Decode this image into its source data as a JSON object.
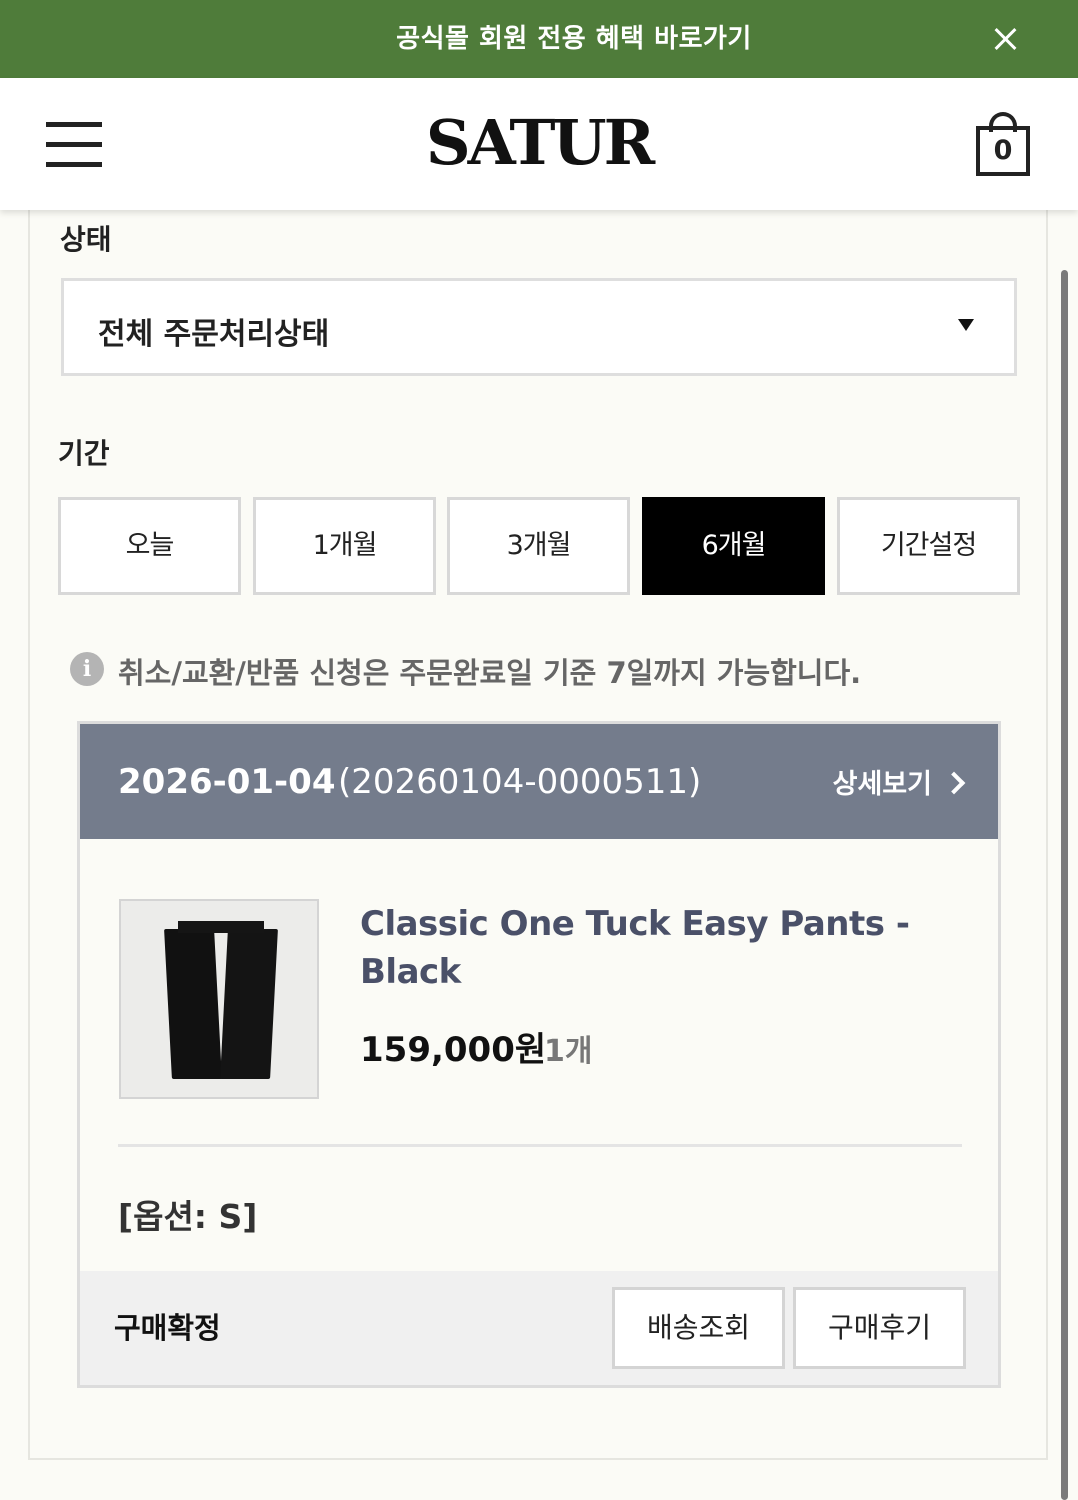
{
  "promo": {
    "text": "공식몰 회원 전용 혜택 바로가기",
    "close_icon": "close-icon"
  },
  "header": {
    "logo": "SATUR",
    "cart_count": "0",
    "menu_icon": "hamburger-icon",
    "cart_icon": "shopping-bag-icon"
  },
  "filter": {
    "status_label": "상태",
    "status_selected": "전체 주문처리상태",
    "period_label": "기간",
    "periods": [
      "오늘",
      "1개월",
      "3개월",
      "6개월",
      "기간설정"
    ],
    "active_period": "6개월"
  },
  "notice": {
    "icon": "info-icon",
    "text": "취소/교환/반품 신청은 주문완료일 기준 7일까지 가능합니다."
  },
  "order": {
    "date": "2026-01-04",
    "number": "(20260104-0000511)",
    "detail_label": "상세보기",
    "product": {
      "name": "Classic One Tuck Easy Pants - Black",
      "price": "159,000원",
      "qty": "1개",
      "option": "[옵션: S]"
    },
    "status": "구매확정",
    "actions": [
      "배송조회",
      "구매후기"
    ]
  },
  "colors": {
    "promo_bg": "#4f7c3a",
    "order_header_bg": "#747c8c",
    "active_period_bg": "#000000",
    "product_name": "#4a5068"
  }
}
